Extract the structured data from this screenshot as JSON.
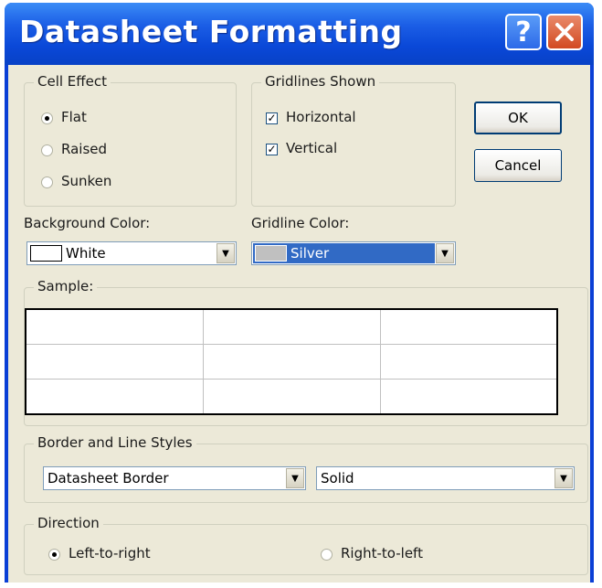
{
  "dialog": {
    "title": "Datasheet Formatting",
    "help_label": "?",
    "close_label": "✕"
  },
  "cell_effect": {
    "title": "Cell Effect",
    "options": [
      {
        "label": "Flat",
        "selected": true
      },
      {
        "label": "Raised",
        "selected": false
      },
      {
        "label": "Sunken",
        "selected": false
      }
    ]
  },
  "gridlines": {
    "title": "Gridlines Shown",
    "options": [
      {
        "label": "Horizontal",
        "checked": true
      },
      {
        "label": "Vertical",
        "checked": true
      }
    ],
    "check_mark": "✓"
  },
  "buttons": {
    "ok": "OK",
    "cancel": "Cancel"
  },
  "background_color": {
    "label": "Background Color:",
    "value": "White",
    "swatch": "#ffffff"
  },
  "gridline_color": {
    "label": "Gridline Color:",
    "value": "Silver",
    "swatch": "#c0c0c0",
    "highlight": "#316ac5"
  },
  "sample": {
    "title": "Sample:"
  },
  "border_styles": {
    "title": "Border and Line Styles",
    "border": "Datasheet Border",
    "line": "Solid"
  },
  "direction": {
    "title": "Direction",
    "options": [
      {
        "label": "Left-to-right",
        "selected": true
      },
      {
        "label": "Right-to-left",
        "selected": false
      }
    ]
  },
  "icons": {
    "dropdown_arrow": "▼"
  }
}
